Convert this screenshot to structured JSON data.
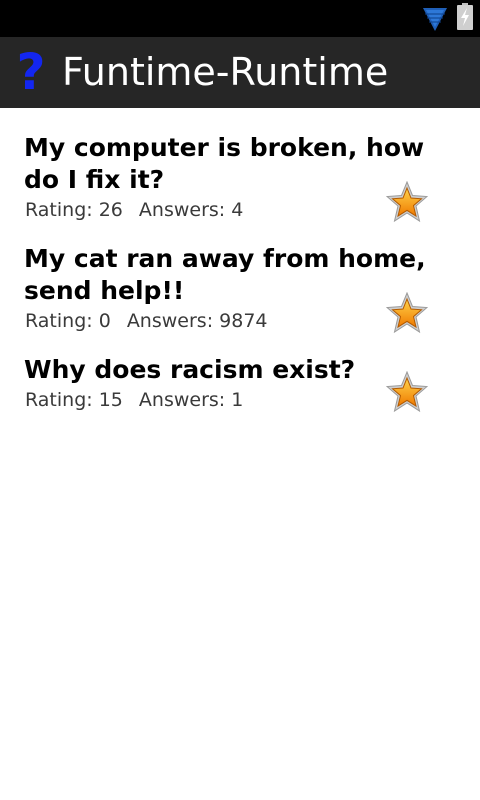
{
  "status_bar": {
    "icons": [
      "wifi-icon",
      "battery-charging-icon"
    ]
  },
  "action_bar": {
    "app_icon": "?",
    "title": "Funtime-Runtime"
  },
  "questions": [
    {
      "title": "My computer is broken, how do I fix it?",
      "rating_label": "Rating:",
      "rating": "26",
      "answers_label": "Answers:",
      "answers": "4",
      "star_icon": "star-icon"
    },
    {
      "title": "My cat ran away from home, send help!!",
      "rating_label": "Rating:",
      "rating": "0",
      "answers_label": "Answers:",
      "answers": "9874",
      "star_icon": "star-icon"
    },
    {
      "title": "Why does racism exist?",
      "rating_label": "Rating:",
      "rating": "15",
      "answers_label": "Answers:",
      "answers": "1",
      "star_icon": "star-icon"
    }
  ],
  "colors": {
    "action_bar_bg": "#262626",
    "app_icon": "#1326f0",
    "star_fill": "#f5a500",
    "wifi": "#1f5fb8"
  }
}
